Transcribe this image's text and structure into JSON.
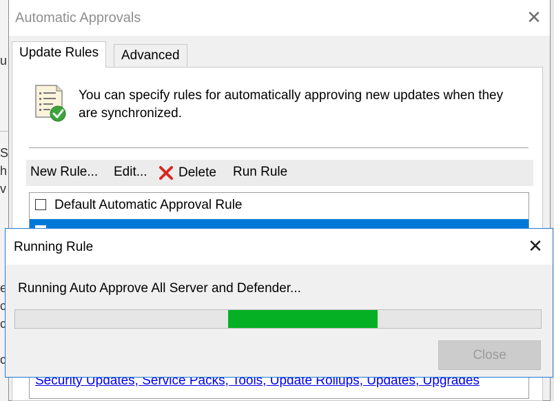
{
  "background_fragments": [
    "u",
    "S",
    "h",
    "v",
    "e",
    "c",
    "c",
    "c"
  ],
  "main_dialog": {
    "title": "Automatic Approvals",
    "close_glyph": "✕",
    "tabs": [
      {
        "label": "Update Rules",
        "active": true
      },
      {
        "label": "Advanced",
        "active": false
      }
    ],
    "description": "You can specify rules for automatically approving new updates when they are synchronized.",
    "toolbar": {
      "new_rule": "New Rule...",
      "edit": "Edit...",
      "delete": "Delete",
      "run_rule": "Run Rule"
    },
    "rules": [
      {
        "name": "Default Automatic Approval Rule",
        "checked": false,
        "selected": false
      },
      {
        "name": "",
        "checked": false,
        "selected": true
      }
    ],
    "rule_properties_link": "Security Updates, Service Packs, Tools, Update Rollups, Updates, Upgrades",
    "icons": {
      "rules": "checklist-approved-icon",
      "delete": "red-x-icon"
    }
  },
  "running_dialog": {
    "title": "Running Rule",
    "close_glyph": "✕",
    "status": "Running Auto Approve All Server and Defender...",
    "progress_marquee": {
      "start_fraction": 0.405,
      "end_fraction": 0.69
    },
    "close_button": "Close",
    "close_enabled": false,
    "colors": {
      "progress": "#06b025",
      "border": "#1f7ad6",
      "selection": "#0078d7"
    }
  }
}
